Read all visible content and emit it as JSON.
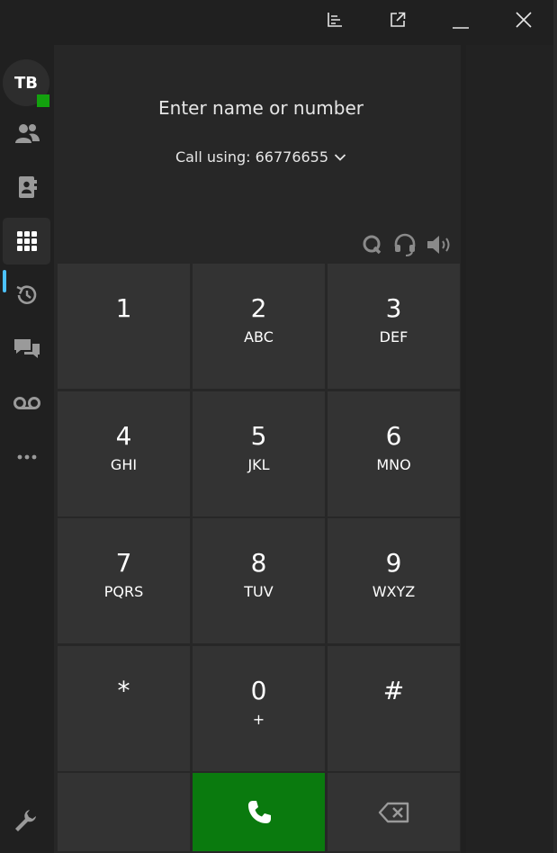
{
  "titlebar": {
    "icons": [
      "stats-icon",
      "popout-icon",
      "minimize-icon",
      "close-icon"
    ]
  },
  "user": {
    "initials": "TB",
    "presence_color": "#13a10e"
  },
  "sidebar": {
    "items": [
      {
        "name": "contacts",
        "icon": "people-icon"
      },
      {
        "name": "address-book",
        "icon": "contact-card-icon"
      },
      {
        "name": "dialpad",
        "icon": "dialpad-icon",
        "active": true
      },
      {
        "name": "history",
        "icon": "history-icon"
      },
      {
        "name": "chat",
        "icon": "chat-icon"
      },
      {
        "name": "voicemail",
        "icon": "voicemail-icon"
      },
      {
        "name": "more",
        "icon": "more-icon"
      }
    ],
    "settings_icon": "wrench-icon"
  },
  "dialer": {
    "placeholder": "Enter name or number",
    "call_using_label": "Call using: 66776655",
    "tools": [
      "q-icon",
      "headset-icon",
      "speaker-icon"
    ]
  },
  "keypad": {
    "keys": [
      {
        "digit": "1",
        "letters": ""
      },
      {
        "digit": "2",
        "letters": "ABC"
      },
      {
        "digit": "3",
        "letters": "DEF"
      },
      {
        "digit": "4",
        "letters": "GHI"
      },
      {
        "digit": "5",
        "letters": "JKL"
      },
      {
        "digit": "6",
        "letters": "MNO"
      },
      {
        "digit": "7",
        "letters": "PQRS"
      },
      {
        "digit": "8",
        "letters": "TUV"
      },
      {
        "digit": "9",
        "letters": "WXYZ"
      },
      {
        "digit": "*",
        "letters": ""
      },
      {
        "digit": "0",
        "letters": "+"
      },
      {
        "digit": "#",
        "letters": ""
      }
    ],
    "call_icon": "phone-icon",
    "backspace_icon": "backspace-icon"
  },
  "colors": {
    "accent": "#4cc2ff",
    "call_button": "#0a7a0e",
    "key_background": "#333333"
  }
}
